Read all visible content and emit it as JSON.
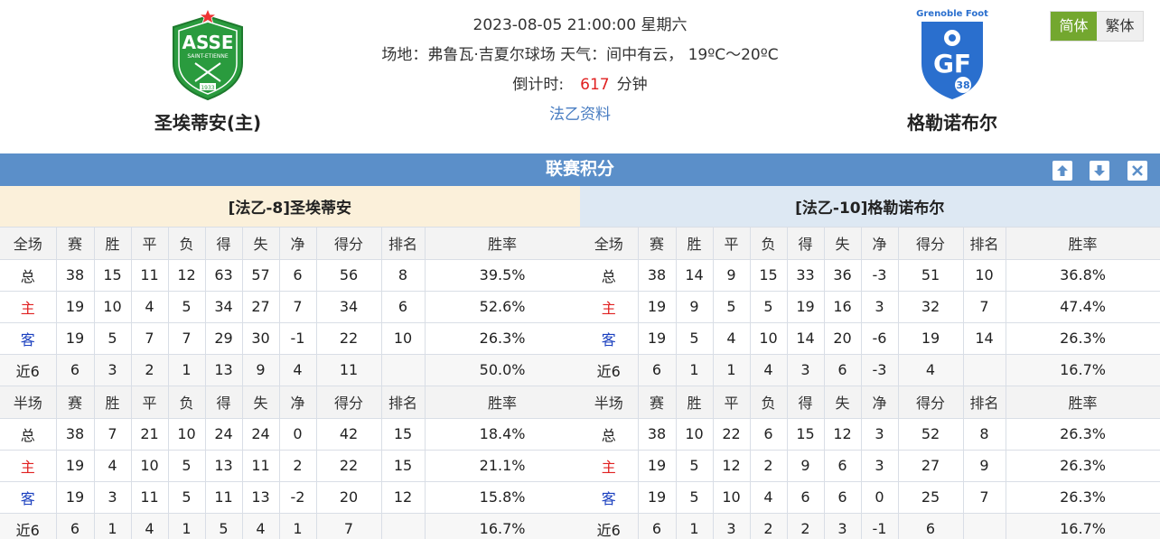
{
  "header": {
    "home_team": "圣埃蒂安(主)",
    "away_team": "格勒诺布尔",
    "datetime": "2023-08-05 21:00:00 星期六",
    "venue": "场地：弗鲁瓦·吉夏尔球场 天气：间中有云， 19ºC～20ºC",
    "countdown_label": "倒计时:",
    "countdown_value": "617",
    "countdown_unit": "分钟",
    "league_link": "法乙资料",
    "home_logo": {
      "text": "ASSE",
      "sub": "SAINT-ETIENNE",
      "year": "1933",
      "color": "#2a9b3e"
    },
    "away_logo": {
      "text": "GF",
      "sub": "Grenoble Foot",
      "num": "38",
      "color": "#2a6fce"
    }
  },
  "lang": {
    "simplified": "简体",
    "traditional": "繁体"
  },
  "section": {
    "title": "联赛积分",
    "colors": {
      "bar": "#5b8fc9",
      "home_accent": "#e02020",
      "away_accent": "#1a3fbf"
    }
  },
  "columns": [
    "赛",
    "胜",
    "平",
    "负",
    "得",
    "失",
    "净",
    "得分",
    "排名",
    "胜率"
  ],
  "home_table": {
    "title": "[法乙-8]圣埃蒂安",
    "full": {
      "label": "全场",
      "rows": [
        {
          "label": "总",
          "v": [
            "38",
            "15",
            "11",
            "12",
            "63",
            "57",
            "6",
            "56",
            "8",
            "39.5%"
          ]
        },
        {
          "label": "主",
          "v": [
            "19",
            "10",
            "4",
            "5",
            "34",
            "27",
            "7",
            "34",
            "6",
            "52.6%"
          ]
        },
        {
          "label": "客",
          "v": [
            "19",
            "5",
            "7",
            "7",
            "29",
            "30",
            "-1",
            "22",
            "10",
            "26.3%"
          ]
        },
        {
          "label": "近6",
          "v": [
            "6",
            "3",
            "2",
            "1",
            "13",
            "9",
            "4",
            "11",
            "",
            "50.0%"
          ]
        }
      ]
    },
    "half": {
      "label": "半场",
      "rows": [
        {
          "label": "总",
          "v": [
            "38",
            "7",
            "21",
            "10",
            "24",
            "24",
            "0",
            "42",
            "15",
            "18.4%"
          ]
        },
        {
          "label": "主",
          "v": [
            "19",
            "4",
            "10",
            "5",
            "13",
            "11",
            "2",
            "22",
            "15",
            "21.1%"
          ]
        },
        {
          "label": "客",
          "v": [
            "19",
            "3",
            "11",
            "5",
            "11",
            "13",
            "-2",
            "20",
            "12",
            "15.8%"
          ]
        },
        {
          "label": "近6",
          "v": [
            "6",
            "1",
            "4",
            "1",
            "5",
            "4",
            "1",
            "7",
            "",
            "16.7%"
          ]
        }
      ]
    }
  },
  "away_table": {
    "title": "[法乙-10]格勒诺布尔",
    "full": {
      "label": "全场",
      "rows": [
        {
          "label": "总",
          "v": [
            "38",
            "14",
            "9",
            "15",
            "33",
            "36",
            "-3",
            "51",
            "10",
            "36.8%"
          ]
        },
        {
          "label": "主",
          "v": [
            "19",
            "9",
            "5",
            "5",
            "19",
            "16",
            "3",
            "32",
            "7",
            "47.4%"
          ]
        },
        {
          "label": "客",
          "v": [
            "19",
            "5",
            "4",
            "10",
            "14",
            "20",
            "-6",
            "19",
            "14",
            "26.3%"
          ]
        },
        {
          "label": "近6",
          "v": [
            "6",
            "1",
            "1",
            "4",
            "3",
            "6",
            "-3",
            "4",
            "",
            "16.7%"
          ]
        }
      ]
    },
    "half": {
      "label": "半场",
      "rows": [
        {
          "label": "总",
          "v": [
            "38",
            "10",
            "22",
            "6",
            "15",
            "12",
            "3",
            "52",
            "8",
            "26.3%"
          ]
        },
        {
          "label": "主",
          "v": [
            "19",
            "5",
            "12",
            "2",
            "9",
            "6",
            "3",
            "27",
            "9",
            "26.3%"
          ]
        },
        {
          "label": "客",
          "v": [
            "19",
            "5",
            "10",
            "4",
            "6",
            "6",
            "0",
            "25",
            "7",
            "26.3%"
          ]
        },
        {
          "label": "近6",
          "v": [
            "6",
            "1",
            "3",
            "2",
            "2",
            "3",
            "-1",
            "6",
            "",
            "16.7%"
          ]
        }
      ]
    }
  }
}
